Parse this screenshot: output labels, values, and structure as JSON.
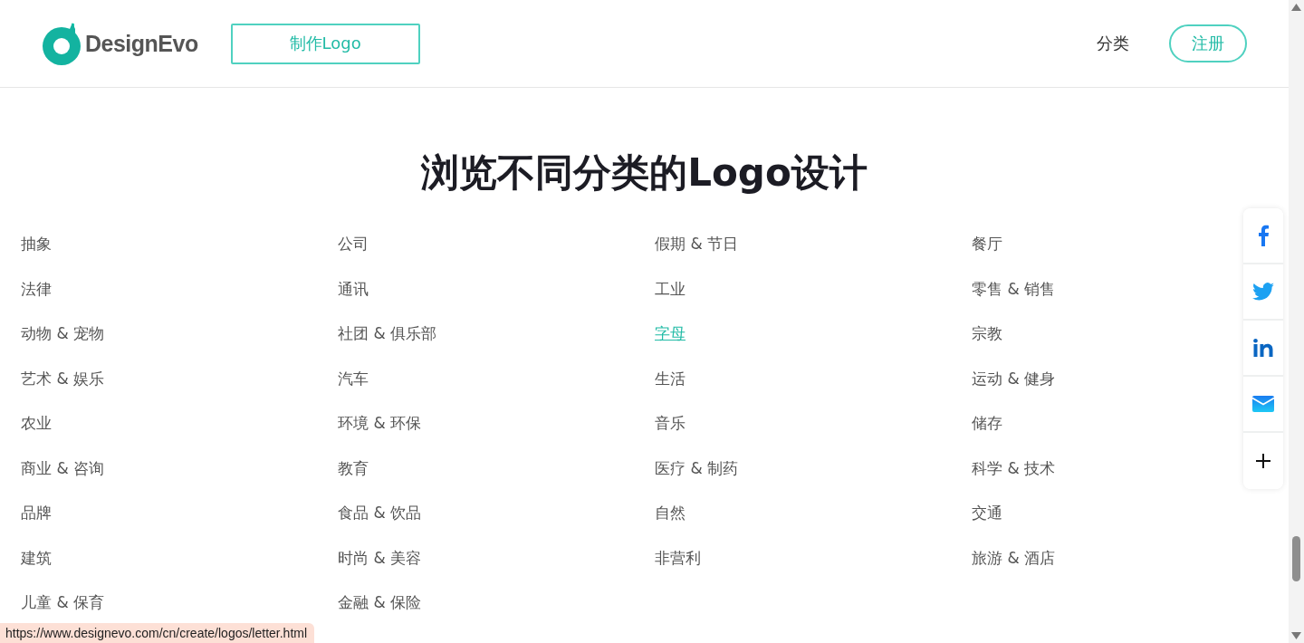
{
  "header": {
    "logo_text": "DesignEvo",
    "make_button": "制作Logo",
    "nav_link": "分类",
    "signup_button": "注册"
  },
  "title": "浏览不同分类的Logo设计",
  "columns": [
    {
      "items": [
        {
          "label": "抽象",
          "selected": false
        },
        {
          "label": "法律",
          "selected": false
        },
        {
          "label": "动物 & 宠物",
          "selected": false
        },
        {
          "label": "艺术 & 娱乐",
          "selected": false
        },
        {
          "label": "农业",
          "selected": false
        },
        {
          "label": "商业 & 咨询",
          "selected": false
        },
        {
          "label": "品牌",
          "selected": false
        },
        {
          "label": "建筑",
          "selected": false
        },
        {
          "label": "儿童 & 保育",
          "selected": false
        }
      ]
    },
    {
      "items": [
        {
          "label": "公司",
          "selected": false
        },
        {
          "label": "通讯",
          "selected": false
        },
        {
          "label": "社团 & 俱乐部",
          "selected": false
        },
        {
          "label": "汽车",
          "selected": false
        },
        {
          "label": "环境 & 环保",
          "selected": false
        },
        {
          "label": "教育",
          "selected": false
        },
        {
          "label": "食品 & 饮品",
          "selected": false
        },
        {
          "label": "时尚 & 美容",
          "selected": false
        },
        {
          "label": "金融 & 保险",
          "selected": false
        }
      ]
    },
    {
      "items": [
        {
          "label": "假期 & 节日",
          "selected": false
        },
        {
          "label": "工业",
          "selected": false
        },
        {
          "label": "字母",
          "selected": true
        },
        {
          "label": "生活",
          "selected": false
        },
        {
          "label": "音乐",
          "selected": false
        },
        {
          "label": "医疗 & 制药",
          "selected": false
        },
        {
          "label": "自然",
          "selected": false
        },
        {
          "label": "非营利",
          "selected": false
        }
      ]
    },
    {
      "items": [
        {
          "label": "餐厅",
          "selected": false
        },
        {
          "label": "零售 & 销售",
          "selected": false
        },
        {
          "label": "宗教",
          "selected": false
        },
        {
          "label": "运动 & 健身",
          "selected": false
        },
        {
          "label": "储存",
          "selected": false
        },
        {
          "label": "科学 & 技术",
          "selected": false
        },
        {
          "label": "交通",
          "selected": false
        },
        {
          "label": "旅游 & 酒店",
          "selected": false
        }
      ]
    }
  ],
  "share_buttons": [
    {
      "kind": "facebook"
    },
    {
      "kind": "twitter"
    },
    {
      "kind": "linkedin"
    },
    {
      "kind": "email"
    },
    {
      "kind": "more"
    }
  ],
  "status_url": "https://www.designevo.com/cn/create/logos/letter.html"
}
